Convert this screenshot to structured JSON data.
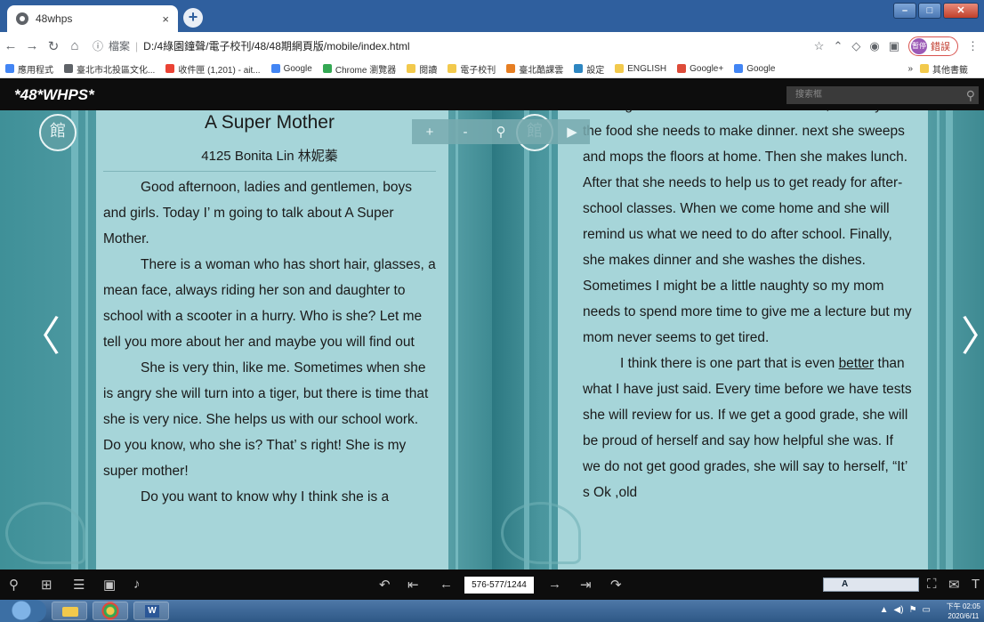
{
  "browser": {
    "tab_title": "48whps",
    "tab_close": "×",
    "new_tab": "+",
    "address": {
      "info_icon": "ⓘ",
      "scheme_label": "檔案",
      "url": "D:/4綠園鐘聲/電子校刊/48/48期網頁版/mobile/index.html"
    },
    "profile_label": "暫停",
    "profile_pill_text": "錯誤",
    "menu_icon": "⋮"
  },
  "bookmarks": [
    {
      "label": "應用程式",
      "icon": "apps-icon"
    },
    {
      "label": "臺北市北投區文化...",
      "icon": "globe-icon"
    },
    {
      "label": "收件匣 (1,201) - ait...",
      "icon": "gmail-icon"
    },
    {
      "label": "Google",
      "icon": "google-icon"
    },
    {
      "label": "Chrome 瀏覽器",
      "icon": "chrome-icon"
    },
    {
      "label": "閱讀",
      "icon": "folder-icon"
    },
    {
      "label": "電子校刊",
      "icon": "folder-icon"
    },
    {
      "label": "臺北酷課雲",
      "icon": "cooc-icon"
    },
    {
      "label": "設定",
      "icon": "gear-icon"
    },
    {
      "label": "ENGLISH",
      "icon": "folder-icon"
    },
    {
      "label": "Google+",
      "icon": "googleplus-icon"
    },
    {
      "label": "Google",
      "icon": "google-icon"
    }
  ],
  "bookmarks_more": "»",
  "bookmarks_other": "其他書籤",
  "app": {
    "brand": "*48*WHPS*",
    "search_placeholder": "搜索框"
  },
  "zoom_controls": {
    "zoom_in": "+",
    "zoom_minus": "-",
    "zoom_search": "🔍",
    "cursor": "▶"
  },
  "left_page": {
    "title": "A Super Mother",
    "author": "4125   Bonita Lin   林妮蓁",
    "paragraphs": [
      "Good afternoon, ladies and gentlemen, boys and girls. Today I’ m going to talk about A Super Mother.",
      "There is a woman who has short hair, glasses, a mean face, always riding her son and daughter to school with a scooter in a hurry. Who is she? Let me tell you more about her and maybe you will find out",
      "She is very thin, like me. Sometimes when she is angry she will turn into a tiger, but there is time that she is very nice. She helps us with our school work. Do you know, who she is? That’ s right! She is my super mother!",
      "Do you want to know why I think she is a"
    ]
  },
  "right_page": {
    "cut_line": "morning and first she takes us to school, she buys",
    "paragraph1": "the food she needs to make dinner. next she sweeps and mops the floors at home. Then she makes lunch. After that she needs to help us to get ready for after-school classes. When we come home and she will remind us what we need to do after school. Finally, she makes dinner and she washes the dishes. Sometimes I might be a little naughty so my mom needs to spend more time to give me a lecture but my mom never seems to get tired.",
    "paragraph2_before": "I think there is one part that is even ",
    "paragraph2_underlined": "better",
    "paragraph2_after": " than what I have just said. Every time before we have tests she will review for us. If we get a good grade, she will be proud of herself and say how helpful she was. If we do not get good grades, she will say to herself,  “It’ s Ok ,old"
  },
  "seal_char": "館",
  "nav": {
    "prev": "〈",
    "next": "〉"
  },
  "toolbar": {
    "page_indicator": "576-577/1244",
    "ime_text": "A"
  },
  "taskbar": {
    "time": "下午 02:05",
    "date": "2020/6/11"
  }
}
